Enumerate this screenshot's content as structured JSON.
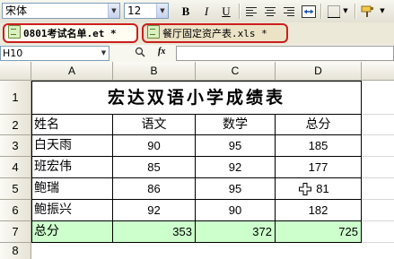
{
  "toolbar": {
    "font_name": "宋体",
    "font_size": "12",
    "bold_label": "B",
    "italic_label": "I",
    "underline_label": "U"
  },
  "tabs": [
    {
      "label": "0801考试名单.et *",
      "active": true
    },
    {
      "label": "餐厅固定资产表.xls *",
      "active": false
    }
  ],
  "formula_bar": {
    "name_box": "H10",
    "fx_label": "fx",
    "formula": ""
  },
  "sheet": {
    "columns": [
      "A",
      "B",
      "C",
      "D"
    ],
    "rows": [
      "1",
      "2",
      "3",
      "4",
      "5",
      "6",
      "7",
      "8"
    ],
    "title": "宏达双语小学成绩表",
    "header": [
      "姓名",
      "语文",
      "数学",
      "总分"
    ],
    "data": [
      [
        "白天雨",
        "90",
        "95",
        "185"
      ],
      [
        "班宏伟",
        "85",
        "92",
        "177"
      ],
      [
        "鲍瑞",
        "86",
        "95",
        "81"
      ],
      [
        "鲍振兴",
        "92",
        "90",
        "182"
      ]
    ],
    "total": [
      "总分",
      "353",
      "372",
      "725"
    ]
  },
  "colors": {
    "total_row_fill": "#ccffcc",
    "tab_highlight_border": "#cc1e1e"
  }
}
